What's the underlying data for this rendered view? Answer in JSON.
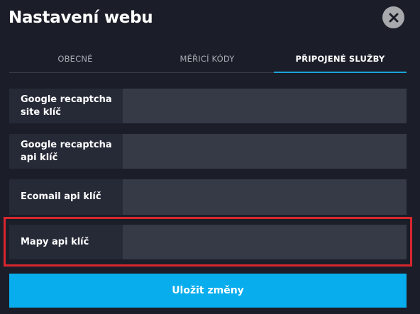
{
  "modal": {
    "title": "Nastavení webu"
  },
  "tabs": [
    {
      "label": "OBECNÉ",
      "active": false
    },
    {
      "label": "MĚŘICÍ KÓDY",
      "active": false
    },
    {
      "label": "PŘIPOJENÉ SLUŽBY",
      "active": true
    }
  ],
  "fields": [
    {
      "label": "Google recaptcha site klíč",
      "value": ""
    },
    {
      "label": "Google recaptcha api klíč",
      "value": ""
    },
    {
      "label": "Ecomail api klíč",
      "value": ""
    },
    {
      "label": "Mapy api klíč",
      "value": "",
      "highlighted": true
    }
  ],
  "actions": {
    "save_label": "Uložit změny"
  },
  "colors": {
    "background": "#1b1e28",
    "row_bg": "#262a37",
    "field_bg": "#363a47",
    "accent": "#08aded",
    "highlight": "#d8262e",
    "close_bg": "#a7a9ad"
  }
}
